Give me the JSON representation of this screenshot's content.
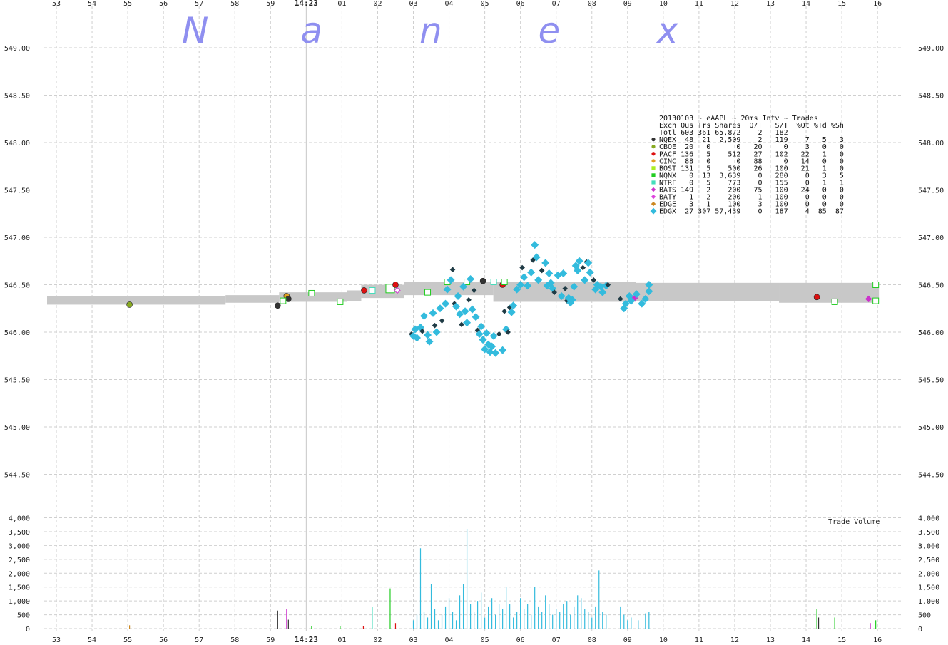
{
  "watermark": [
    "N",
    "a",
    "n",
    "e",
    "x"
  ],
  "chart_data": {
    "type": "scatter",
    "title": "20130103 ~ eAAPL ~ 20ms Intv ~ Trades",
    "x_tick_labels": [
      "53",
      "54",
      "55",
      "56",
      "57",
      "58",
      "59",
      "14:23",
      "01",
      "02",
      "03",
      "04",
      "05",
      "06",
      "07",
      "08",
      "09",
      "10",
      "11",
      "12",
      "13",
      "14",
      "15",
      "16"
    ],
    "x_range_s": [
      -8,
      15
    ],
    "price_axis": {
      "ticks": [
        549.0,
        548.5,
        548.0,
        547.5,
        547.0,
        546.5,
        546.0,
        545.5,
        545.0,
        544.5
      ],
      "ylim": [
        544.2,
        549.3
      ]
    },
    "volume_axis": {
      "label": "Trade Volume",
      "ticks": [
        4000,
        3500,
        3000,
        2500,
        2000,
        1500,
        1000,
        500,
        0
      ],
      "tick_labels": [
        "4,000",
        "3,500",
        "3,000",
        "2,500",
        "2,000",
        "1,500",
        "1,000",
        "500",
        "0"
      ],
      "ylim": [
        0,
        4000
      ]
    },
    "quote_band": [
      {
        "x0": -8.0,
        "x1": -3.0,
        "low": 546.29,
        "high": 546.38
      },
      {
        "x0": -3.0,
        "x1": -1.5,
        "low": 546.31,
        "high": 546.39
      },
      {
        "x0": -1.5,
        "x1": 0.4,
        "low": 546.32,
        "high": 546.42
      },
      {
        "x0": 0.4,
        "x1": 0.8,
        "low": 546.33,
        "high": 546.44
      },
      {
        "x0": 0.8,
        "x1": 2.0,
        "low": 546.36,
        "high": 546.5
      },
      {
        "x0": 2.0,
        "x1": 4.5,
        "low": 546.39,
        "high": 546.53
      },
      {
        "x0": 4.5,
        "x1": 8.5,
        "low": 546.32,
        "high": 546.53
      },
      {
        "x0": 8.5,
        "x1": 12.5,
        "low": 546.33,
        "high": 546.52
      },
      {
        "x0": 12.5,
        "x1": 15.3,
        "low": 546.31,
        "high": 546.52
      }
    ],
    "legend": {
      "header": "Exch Qus Trs Shares  Q/T   S/T  %Qt %Td %Sh",
      "rows": [
        {
          "exch": "Totl",
          "line": "Totl 603 361 65,872    2   182",
          "marker": "none",
          "color": ""
        },
        {
          "exch": "NQEX",
          "line": "NQEX  48  21  2,509    2   119    7   5   3",
          "marker": "circle",
          "color": "#333333"
        },
        {
          "exch": "CBOE",
          "line": "CBOE  20   0      0   20     0    3   0   0",
          "marker": "circle",
          "color": "#88aa22"
        },
        {
          "exch": "PACF",
          "line": "PACF 136   5    512   27   102   22   1   0",
          "marker": "circle",
          "color": "#dd1111"
        },
        {
          "exch": "CINC",
          "line": "CINC  88   0      0   88     0   14   0   0",
          "marker": "circle",
          "color": "#e0a020"
        },
        {
          "exch": "BOST",
          "line": "BOST 131   5    500   26   100   21   1   0",
          "marker": "square",
          "color": "#aaee22"
        },
        {
          "exch": "NQNX",
          "line": "NQNX   0  13  3,639    0   280    0   3   5",
          "marker": "square",
          "color": "#22cc22"
        },
        {
          "exch": "NTRF",
          "line": "NTRF   0   5    773    0   155    0   1   1",
          "marker": "square",
          "color": "#44ddbb"
        },
        {
          "exch": "BATS",
          "line": "BATS 149   2    200   75   100   24   0   0",
          "marker": "diamond",
          "color": "#cc33cc"
        },
        {
          "exch": "BATY",
          "line": "BATY   1   2    200    1   100    0   0   0",
          "marker": "diamond",
          "color": "#dd44dd"
        },
        {
          "exch": "EDGE",
          "line": "EDGE   3   1    100    3   100    0   0   0",
          "marker": "diamond",
          "color": "#cc8822"
        },
        {
          "exch": "EDGX",
          "line": "EDGX  27 307 57,439    0   187    4  85  87",
          "marker": "diamond",
          "color": "#33bbdd"
        }
      ]
    },
    "quotes": [
      {
        "x": -5.95,
        "y": 546.29,
        "ex": "CBOE"
      },
      {
        "x": -1.8,
        "y": 546.28,
        "ex": "NQEX"
      },
      {
        "x": -1.55,
        "y": 546.38,
        "ex": "CINC"
      },
      {
        "x": -1.5,
        "y": 546.35,
        "ex": "NQEX"
      },
      {
        "x": -1.65,
        "y": 546.33,
        "ex": "NQNX"
      },
      {
        "x": -0.85,
        "y": 546.41,
        "ex": "NQNX"
      },
      {
        "x": -0.05,
        "y": 546.32,
        "ex": "NQNX"
      },
      {
        "x": 0.62,
        "y": 546.44,
        "ex": "PACF"
      },
      {
        "x": 0.85,
        "y": 546.44,
        "ex": "NTRF"
      },
      {
        "x": 1.35,
        "y": 546.46,
        "ex": "NQNX",
        "big": true
      },
      {
        "x": 1.5,
        "y": 546.5,
        "ex": "PACF"
      },
      {
        "x": 1.55,
        "y": 546.44,
        "ex": "BATS"
      },
      {
        "x": 2.4,
        "y": 546.42,
        "ex": "NQNX"
      },
      {
        "x": 2.95,
        "y": 546.53,
        "ex": "NQNX"
      },
      {
        "x": 3.5,
        "y": 546.53,
        "ex": "NQNX"
      },
      {
        "x": 3.95,
        "y": 546.54,
        "ex": "NQEX"
      },
      {
        "x": 4.25,
        "y": 546.53,
        "ex": "NTRF"
      },
      {
        "x": 4.5,
        "y": 546.5,
        "ex": "PACF"
      },
      {
        "x": 4.55,
        "y": 546.53,
        "ex": "NQNX"
      },
      {
        "x": 8.2,
        "y": 546.36,
        "ex": "BATS"
      },
      {
        "x": 13.3,
        "y": 546.37,
        "ex": "PACF"
      },
      {
        "x": 13.8,
        "y": 546.32,
        "ex": "NQNX"
      },
      {
        "x": 14.95,
        "y": 546.5,
        "ex": "NQNX"
      },
      {
        "x": 14.95,
        "y": 546.33,
        "ex": "NQNX"
      },
      {
        "x": 14.75,
        "y": 546.35,
        "ex": "BATS"
      }
    ],
    "trades": [
      {
        "x": 1.95,
        "y": 545.98,
        "ex": "NQEX"
      },
      {
        "x": 2.0,
        "y": 545.96,
        "ex": "EDGX"
      },
      {
        "x": 2.05,
        "y": 546.03,
        "ex": "EDGX"
      },
      {
        "x": 2.1,
        "y": 545.94,
        "ex": "EDGX"
      },
      {
        "x": 2.2,
        "y": 546.05,
        "ex": "EDGX"
      },
      {
        "x": 2.25,
        "y": 546.01,
        "ex": "NQEX"
      },
      {
        "x": 2.3,
        "y": 546.17,
        "ex": "EDGX"
      },
      {
        "x": 2.4,
        "y": 545.97,
        "ex": "EDGX"
      },
      {
        "x": 2.45,
        "y": 545.9,
        "ex": "EDGX"
      },
      {
        "x": 2.55,
        "y": 546.2,
        "ex": "EDGX"
      },
      {
        "x": 2.6,
        "y": 546.07,
        "ex": "NQEX"
      },
      {
        "x": 2.65,
        "y": 546.0,
        "ex": "EDGX"
      },
      {
        "x": 2.75,
        "y": 546.25,
        "ex": "EDGX"
      },
      {
        "x": 2.8,
        "y": 546.12,
        "ex": "NQEX"
      },
      {
        "x": 2.9,
        "y": 546.3,
        "ex": "EDGX"
      },
      {
        "x": 2.95,
        "y": 546.45,
        "ex": "EDGX"
      },
      {
        "x": 3.05,
        "y": 546.55,
        "ex": "EDGX"
      },
      {
        "x": 3.1,
        "y": 546.66,
        "ex": "NQEX"
      },
      {
        "x": 3.15,
        "y": 546.3,
        "ex": "NQEX"
      },
      {
        "x": 3.2,
        "y": 546.27,
        "ex": "EDGX"
      },
      {
        "x": 3.25,
        "y": 546.38,
        "ex": "EDGX"
      },
      {
        "x": 3.3,
        "y": 546.19,
        "ex": "EDGX"
      },
      {
        "x": 3.35,
        "y": 546.08,
        "ex": "NQEX"
      },
      {
        "x": 3.4,
        "y": 546.48,
        "ex": "EDGX"
      },
      {
        "x": 3.45,
        "y": 546.22,
        "ex": "EDGX"
      },
      {
        "x": 3.5,
        "y": 546.1,
        "ex": "EDGX"
      },
      {
        "x": 3.55,
        "y": 546.34,
        "ex": "NQEX"
      },
      {
        "x": 3.6,
        "y": 546.56,
        "ex": "EDGX"
      },
      {
        "x": 3.65,
        "y": 546.24,
        "ex": "EDGX"
      },
      {
        "x": 3.7,
        "y": 546.44,
        "ex": "NQEX"
      },
      {
        "x": 3.75,
        "y": 546.16,
        "ex": "EDGX"
      },
      {
        "x": 3.8,
        "y": 546.02,
        "ex": "NQEX"
      },
      {
        "x": 3.85,
        "y": 545.98,
        "ex": "EDGX"
      },
      {
        "x": 3.9,
        "y": 546.06,
        "ex": "EDGX"
      },
      {
        "x": 3.95,
        "y": 545.92,
        "ex": "EDGX"
      },
      {
        "x": 4.0,
        "y": 545.82,
        "ex": "EDGX"
      },
      {
        "x": 4.05,
        "y": 545.99,
        "ex": "EDGX"
      },
      {
        "x": 4.1,
        "y": 545.87,
        "ex": "EDGX"
      },
      {
        "x": 4.15,
        "y": 545.79,
        "ex": "EDGX"
      },
      {
        "x": 4.2,
        "y": 545.85,
        "ex": "EDGX"
      },
      {
        "x": 4.25,
        "y": 545.96,
        "ex": "EDGX"
      },
      {
        "x": 4.3,
        "y": 545.78,
        "ex": "EDGX"
      },
      {
        "x": 4.4,
        "y": 545.98,
        "ex": "NQEX"
      },
      {
        "x": 4.5,
        "y": 545.81,
        "ex": "EDGX"
      },
      {
        "x": 4.55,
        "y": 546.22,
        "ex": "NQEX"
      },
      {
        "x": 4.6,
        "y": 546.03,
        "ex": "EDGX"
      },
      {
        "x": 4.65,
        "y": 546.0,
        "ex": "NQEX"
      },
      {
        "x": 4.7,
        "y": 546.26,
        "ex": "NQEX"
      },
      {
        "x": 4.75,
        "y": 546.21,
        "ex": "EDGX"
      },
      {
        "x": 4.8,
        "y": 546.28,
        "ex": "EDGX"
      },
      {
        "x": 4.9,
        "y": 546.45,
        "ex": "EDGX"
      },
      {
        "x": 5.0,
        "y": 546.5,
        "ex": "EDGX"
      },
      {
        "x": 5.05,
        "y": 546.68,
        "ex": "NQEX"
      },
      {
        "x": 5.1,
        "y": 546.58,
        "ex": "EDGX"
      },
      {
        "x": 5.2,
        "y": 546.49,
        "ex": "EDGX"
      },
      {
        "x": 5.3,
        "y": 546.63,
        "ex": "EDGX"
      },
      {
        "x": 5.35,
        "y": 546.76,
        "ex": "NQEX"
      },
      {
        "x": 5.4,
        "y": 546.92,
        "ex": "EDGX"
      },
      {
        "x": 5.45,
        "y": 546.79,
        "ex": "EDGX"
      },
      {
        "x": 5.5,
        "y": 546.55,
        "ex": "EDGX"
      },
      {
        "x": 5.6,
        "y": 546.65,
        "ex": "NQEX"
      },
      {
        "x": 5.7,
        "y": 546.73,
        "ex": "EDGX"
      },
      {
        "x": 5.75,
        "y": 546.49,
        "ex": "EDGX"
      },
      {
        "x": 5.8,
        "y": 546.62,
        "ex": "EDGX"
      },
      {
        "x": 5.85,
        "y": 546.52,
        "ex": "EDGX"
      },
      {
        "x": 5.9,
        "y": 546.46,
        "ex": "EDGX"
      },
      {
        "x": 5.95,
        "y": 546.42,
        "ex": "NQEX"
      },
      {
        "x": 6.05,
        "y": 546.6,
        "ex": "EDGX"
      },
      {
        "x": 6.15,
        "y": 546.38,
        "ex": "EDGX"
      },
      {
        "x": 6.2,
        "y": 546.62,
        "ex": "EDGX"
      },
      {
        "x": 6.25,
        "y": 546.46,
        "ex": "NQEX"
      },
      {
        "x": 6.3,
        "y": 546.33,
        "ex": "NQEX"
      },
      {
        "x": 6.35,
        "y": 546.36,
        "ex": "EDGX"
      },
      {
        "x": 6.4,
        "y": 546.31,
        "ex": "EDGX"
      },
      {
        "x": 6.45,
        "y": 546.34,
        "ex": "EDGX"
      },
      {
        "x": 6.5,
        "y": 546.48,
        "ex": "EDGX"
      },
      {
        "x": 6.55,
        "y": 546.7,
        "ex": "EDGX"
      },
      {
        "x": 6.6,
        "y": 546.65,
        "ex": "EDGX"
      },
      {
        "x": 6.65,
        "y": 546.75,
        "ex": "EDGX"
      },
      {
        "x": 6.75,
        "y": 546.68,
        "ex": "NQEX"
      },
      {
        "x": 6.8,
        "y": 546.55,
        "ex": "EDGX"
      },
      {
        "x": 6.85,
        "y": 546.74,
        "ex": "NQEX"
      },
      {
        "x": 6.9,
        "y": 546.73,
        "ex": "EDGX"
      },
      {
        "x": 6.95,
        "y": 546.63,
        "ex": "EDGX"
      },
      {
        "x": 7.05,
        "y": 546.55,
        "ex": "NQEX"
      },
      {
        "x": 7.1,
        "y": 546.45,
        "ex": "EDGX"
      },
      {
        "x": 7.15,
        "y": 546.5,
        "ex": "EDGX"
      },
      {
        "x": 7.25,
        "y": 546.48,
        "ex": "EDGX"
      },
      {
        "x": 7.3,
        "y": 546.42,
        "ex": "EDGX"
      },
      {
        "x": 7.4,
        "y": 546.49,
        "ex": "EDGX"
      },
      {
        "x": 7.45,
        "y": 546.5,
        "ex": "NQEX"
      },
      {
        "x": 7.8,
        "y": 546.35,
        "ex": "NQEX"
      },
      {
        "x": 7.9,
        "y": 546.25,
        "ex": "EDGX"
      },
      {
        "x": 7.95,
        "y": 546.3,
        "ex": "EDGX"
      },
      {
        "x": 8.05,
        "y": 546.38,
        "ex": "EDGX"
      },
      {
        "x": 8.1,
        "y": 546.33,
        "ex": "EDGX"
      },
      {
        "x": 8.25,
        "y": 546.4,
        "ex": "EDGX"
      },
      {
        "x": 8.4,
        "y": 546.3,
        "ex": "EDGX"
      },
      {
        "x": 8.5,
        "y": 546.35,
        "ex": "EDGX"
      },
      {
        "x": 8.6,
        "y": 546.43,
        "ex": "EDGX"
      },
      {
        "x": 8.6,
        "y": 546.5,
        "ex": "EDGX"
      }
    ],
    "volume_bars": [
      {
        "x": -5.95,
        "v": 120,
        "ex": "EDGE"
      },
      {
        "x": -1.8,
        "v": 650,
        "ex": "NQEX"
      },
      {
        "x": -1.55,
        "v": 700,
        "ex": "BATS"
      },
      {
        "x": -1.5,
        "v": 320,
        "ex": "NQEX"
      },
      {
        "x": -0.85,
        "v": 80,
        "ex": "NQNX"
      },
      {
        "x": -0.05,
        "v": 100,
        "ex": "NQNX"
      },
      {
        "x": 0.6,
        "v": 100,
        "ex": "PACF"
      },
      {
        "x": 0.85,
        "v": 780,
        "ex": "NTRF"
      },
      {
        "x": 1.35,
        "v": 1450,
        "ex": "NQNX"
      },
      {
        "x": 1.5,
        "v": 200,
        "ex": "PACF"
      },
      {
        "x": 2.0,
        "v": 300,
        "ex": "EDGX"
      },
      {
        "x": 2.1,
        "v": 500,
        "ex": "EDGX"
      },
      {
        "x": 2.2,
        "v": 2900,
        "ex": "EDGX"
      },
      {
        "x": 2.3,
        "v": 600,
        "ex": "EDGX"
      },
      {
        "x": 2.4,
        "v": 400,
        "ex": "EDGX"
      },
      {
        "x": 2.5,
        "v": 1600,
        "ex": "EDGX"
      },
      {
        "x": 2.6,
        "v": 700,
        "ex": "EDGX"
      },
      {
        "x": 2.7,
        "v": 300,
        "ex": "EDGX"
      },
      {
        "x": 2.8,
        "v": 500,
        "ex": "EDGX"
      },
      {
        "x": 2.9,
        "v": 800,
        "ex": "EDGX"
      },
      {
        "x": 3.0,
        "v": 1100,
        "ex": "EDGX"
      },
      {
        "x": 3.1,
        "v": 600,
        "ex": "EDGX"
      },
      {
        "x": 3.2,
        "v": 300,
        "ex": "EDGX"
      },
      {
        "x": 3.3,
        "v": 1200,
        "ex": "EDGX"
      },
      {
        "x": 3.4,
        "v": 1600,
        "ex": "EDGX"
      },
      {
        "x": 3.5,
        "v": 3600,
        "ex": "EDGX"
      },
      {
        "x": 3.6,
        "v": 900,
        "ex": "EDGX"
      },
      {
        "x": 3.7,
        "v": 600,
        "ex": "EDGX"
      },
      {
        "x": 3.8,
        "v": 1000,
        "ex": "EDGX"
      },
      {
        "x": 3.9,
        "v": 1300,
        "ex": "EDGX"
      },
      {
        "x": 4.0,
        "v": 400,
        "ex": "EDGX"
      },
      {
        "x": 4.1,
        "v": 800,
        "ex": "EDGX"
      },
      {
        "x": 4.2,
        "v": 1100,
        "ex": "EDGX"
      },
      {
        "x": 4.3,
        "v": 500,
        "ex": "EDGX"
      },
      {
        "x": 4.4,
        "v": 900,
        "ex": "EDGX"
      },
      {
        "x": 4.5,
        "v": 700,
        "ex": "EDGX"
      },
      {
        "x": 4.6,
        "v": 1500,
        "ex": "EDGX"
      },
      {
        "x": 4.7,
        "v": 900,
        "ex": "EDGX"
      },
      {
        "x": 4.8,
        "v": 400,
        "ex": "EDGX"
      },
      {
        "x": 4.9,
        "v": 600,
        "ex": "EDGX"
      },
      {
        "x": 5.0,
        "v": 1100,
        "ex": "EDGX"
      },
      {
        "x": 5.1,
        "v": 700,
        "ex": "EDGX"
      },
      {
        "x": 5.2,
        "v": 900,
        "ex": "EDGX"
      },
      {
        "x": 5.3,
        "v": 500,
        "ex": "EDGX"
      },
      {
        "x": 5.4,
        "v": 1500,
        "ex": "EDGX"
      },
      {
        "x": 5.5,
        "v": 800,
        "ex": "EDGX"
      },
      {
        "x": 5.6,
        "v": 600,
        "ex": "EDGX"
      },
      {
        "x": 5.7,
        "v": 1200,
        "ex": "EDGX"
      },
      {
        "x": 5.8,
        "v": 900,
        "ex": "EDGX"
      },
      {
        "x": 5.9,
        "v": 500,
        "ex": "EDGX"
      },
      {
        "x": 6.0,
        "v": 700,
        "ex": "EDGX"
      },
      {
        "x": 6.1,
        "v": 600,
        "ex": "EDGX"
      },
      {
        "x": 6.2,
        "v": 900,
        "ex": "EDGX"
      },
      {
        "x": 6.3,
        "v": 1000,
        "ex": "EDGX"
      },
      {
        "x": 6.4,
        "v": 500,
        "ex": "EDGX"
      },
      {
        "x": 6.5,
        "v": 800,
        "ex": "EDGX"
      },
      {
        "x": 6.6,
        "v": 1200,
        "ex": "EDGX"
      },
      {
        "x": 6.7,
        "v": 1100,
        "ex": "EDGX"
      },
      {
        "x": 6.8,
        "v": 700,
        "ex": "EDGX"
      },
      {
        "x": 6.9,
        "v": 600,
        "ex": "EDGX"
      },
      {
        "x": 7.0,
        "v": 400,
        "ex": "EDGX"
      },
      {
        "x": 7.1,
        "v": 800,
        "ex": "EDGX"
      },
      {
        "x": 7.2,
        "v": 2100,
        "ex": "EDGX"
      },
      {
        "x": 7.3,
        "v": 600,
        "ex": "EDGX"
      },
      {
        "x": 7.4,
        "v": 500,
        "ex": "EDGX"
      },
      {
        "x": 7.8,
        "v": 800,
        "ex": "EDGX"
      },
      {
        "x": 7.9,
        "v": 500,
        "ex": "EDGX"
      },
      {
        "x": 8.0,
        "v": 300,
        "ex": "EDGX"
      },
      {
        "x": 8.1,
        "v": 400,
        "ex": "EDGX"
      },
      {
        "x": 8.3,
        "v": 300,
        "ex": "EDGX"
      },
      {
        "x": 8.5,
        "v": 550,
        "ex": "EDGX"
      },
      {
        "x": 8.6,
        "v": 600,
        "ex": "EDGX"
      },
      {
        "x": 13.3,
        "v": 700,
        "ex": "NQNX"
      },
      {
        "x": 13.35,
        "v": 400,
        "ex": "NQEX"
      },
      {
        "x": 13.8,
        "v": 400,
        "ex": "NQNX"
      },
      {
        "x": 14.8,
        "v": 200,
        "ex": "BATS"
      },
      {
        "x": 14.95,
        "v": 300,
        "ex": "NQNX"
      }
    ]
  }
}
